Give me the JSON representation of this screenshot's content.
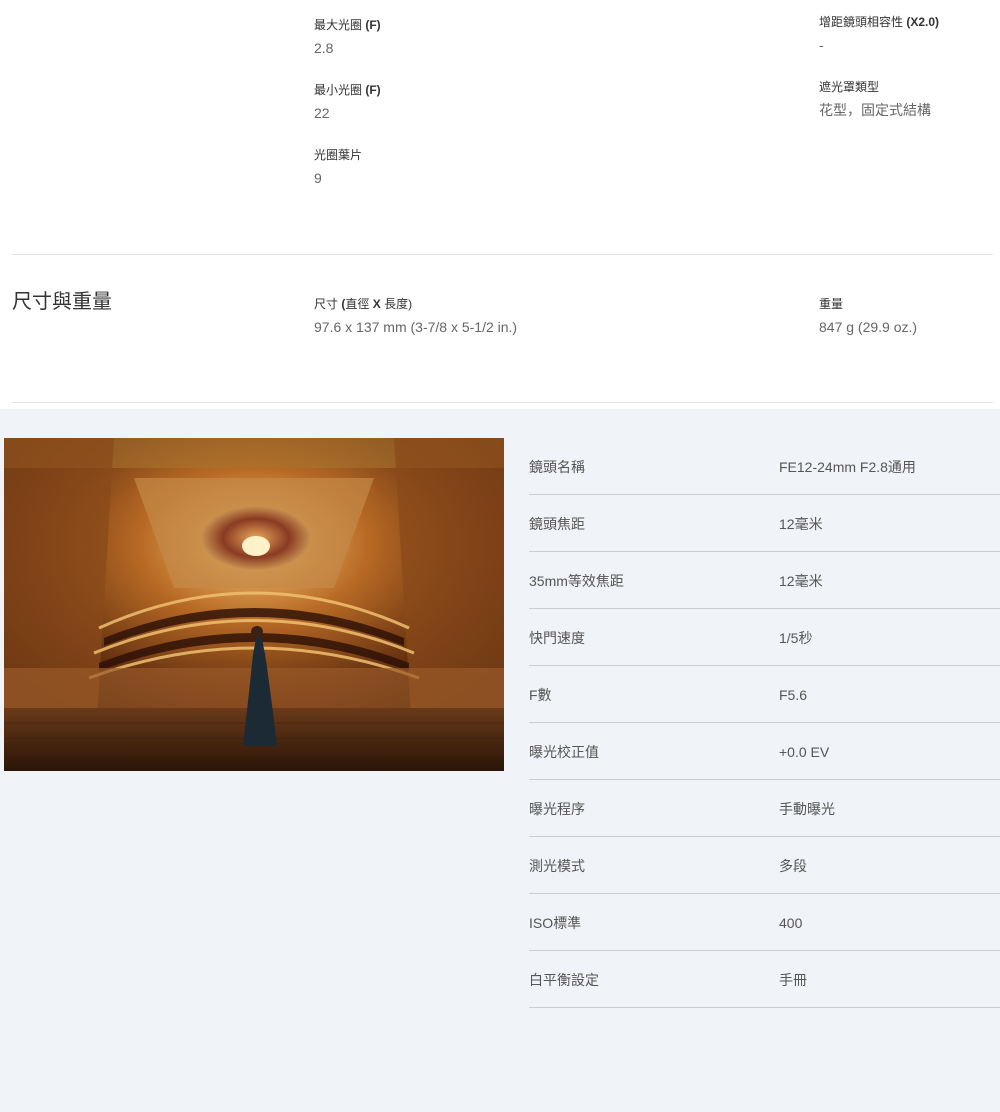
{
  "specs": {
    "max_aperture": {
      "label": "最大光圈",
      "label_bold": "(F)",
      "value": "2.8"
    },
    "min_aperture": {
      "label": "最小光圈",
      "label_bold": "(F)",
      "value": "22"
    },
    "aperture_blades": {
      "label": "光圈葉片",
      "value": "9"
    },
    "teleconverter": {
      "label": "增距鏡頭相容性",
      "label_bold": "(X2.0)",
      "value": "-"
    },
    "hood_type": {
      "label": "遮光罩類型",
      "value": "花型，固定式結構"
    }
  },
  "dimensions_section": {
    "title": "尺寸與重量",
    "size": {
      "label_pre": "尺寸",
      "label_b1": "(",
      "label_mid": "直徑",
      "label_b2": "X",
      "label_post": "長度)",
      "value": "97.6 x 137 mm (3-7/8 x 5-1/2 in.)"
    },
    "weight": {
      "label": "重量",
      "value": "847 g (29.9 oz.)"
    }
  },
  "exif": [
    {
      "key": "鏡頭名稱",
      "value": "FE12-24mm F2.8通用"
    },
    {
      "key": "鏡頭焦距",
      "value": "12毫米"
    },
    {
      "key": "35mm等效焦距",
      "value": "12毫米"
    },
    {
      "key": "快門速度",
      "value": "1/5秒"
    },
    {
      "key": "F數",
      "value": "F5.6"
    },
    {
      "key": "曝光校正值",
      "value": "+0.0 EV"
    },
    {
      "key": "曝光程序",
      "value": "手動曝光"
    },
    {
      "key": "測光模式",
      "value": "多段"
    },
    {
      "key": "ISO標準",
      "value": "400"
    },
    {
      "key": "白平衡設定",
      "value": "手冊"
    }
  ],
  "colors": {
    "gallery_bg": "#f0f3f7",
    "divider": "#c9ccd1"
  }
}
